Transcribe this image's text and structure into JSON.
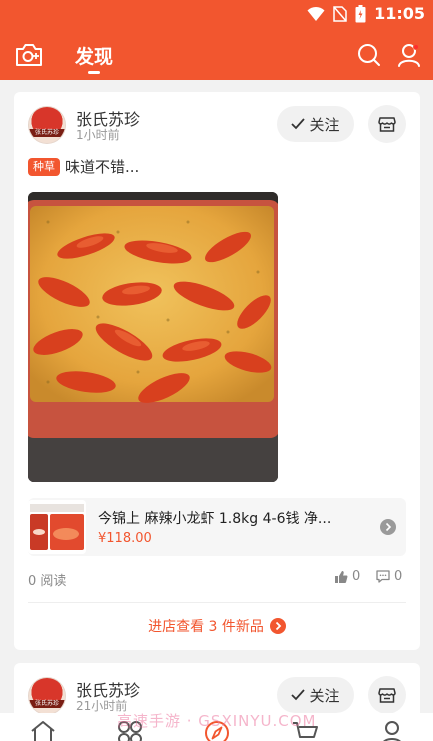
{
  "status_bar": {
    "time": "11:05"
  },
  "app_bar": {
    "title": "发现"
  },
  "posts": [
    {
      "shop_name": "张氏苏珍",
      "time": "1小时前",
      "follow_label": "关注",
      "tag": "种草",
      "caption": "味道不错...",
      "product": {
        "title": "今锦上 麻辣小龙虾 1.8kg 4-6钱 净...",
        "price": "¥118.00"
      },
      "read_count": "0 阅读",
      "likes": "0",
      "comments": "0",
      "shop_link": "进店查看 3 件新品"
    },
    {
      "shop_name": "张氏苏珍",
      "time": "21小时前",
      "follow_label": "关注"
    }
  ],
  "watermark": "高速手游 · GSXINYU.COM",
  "colors": {
    "accent": "#f2562f"
  }
}
